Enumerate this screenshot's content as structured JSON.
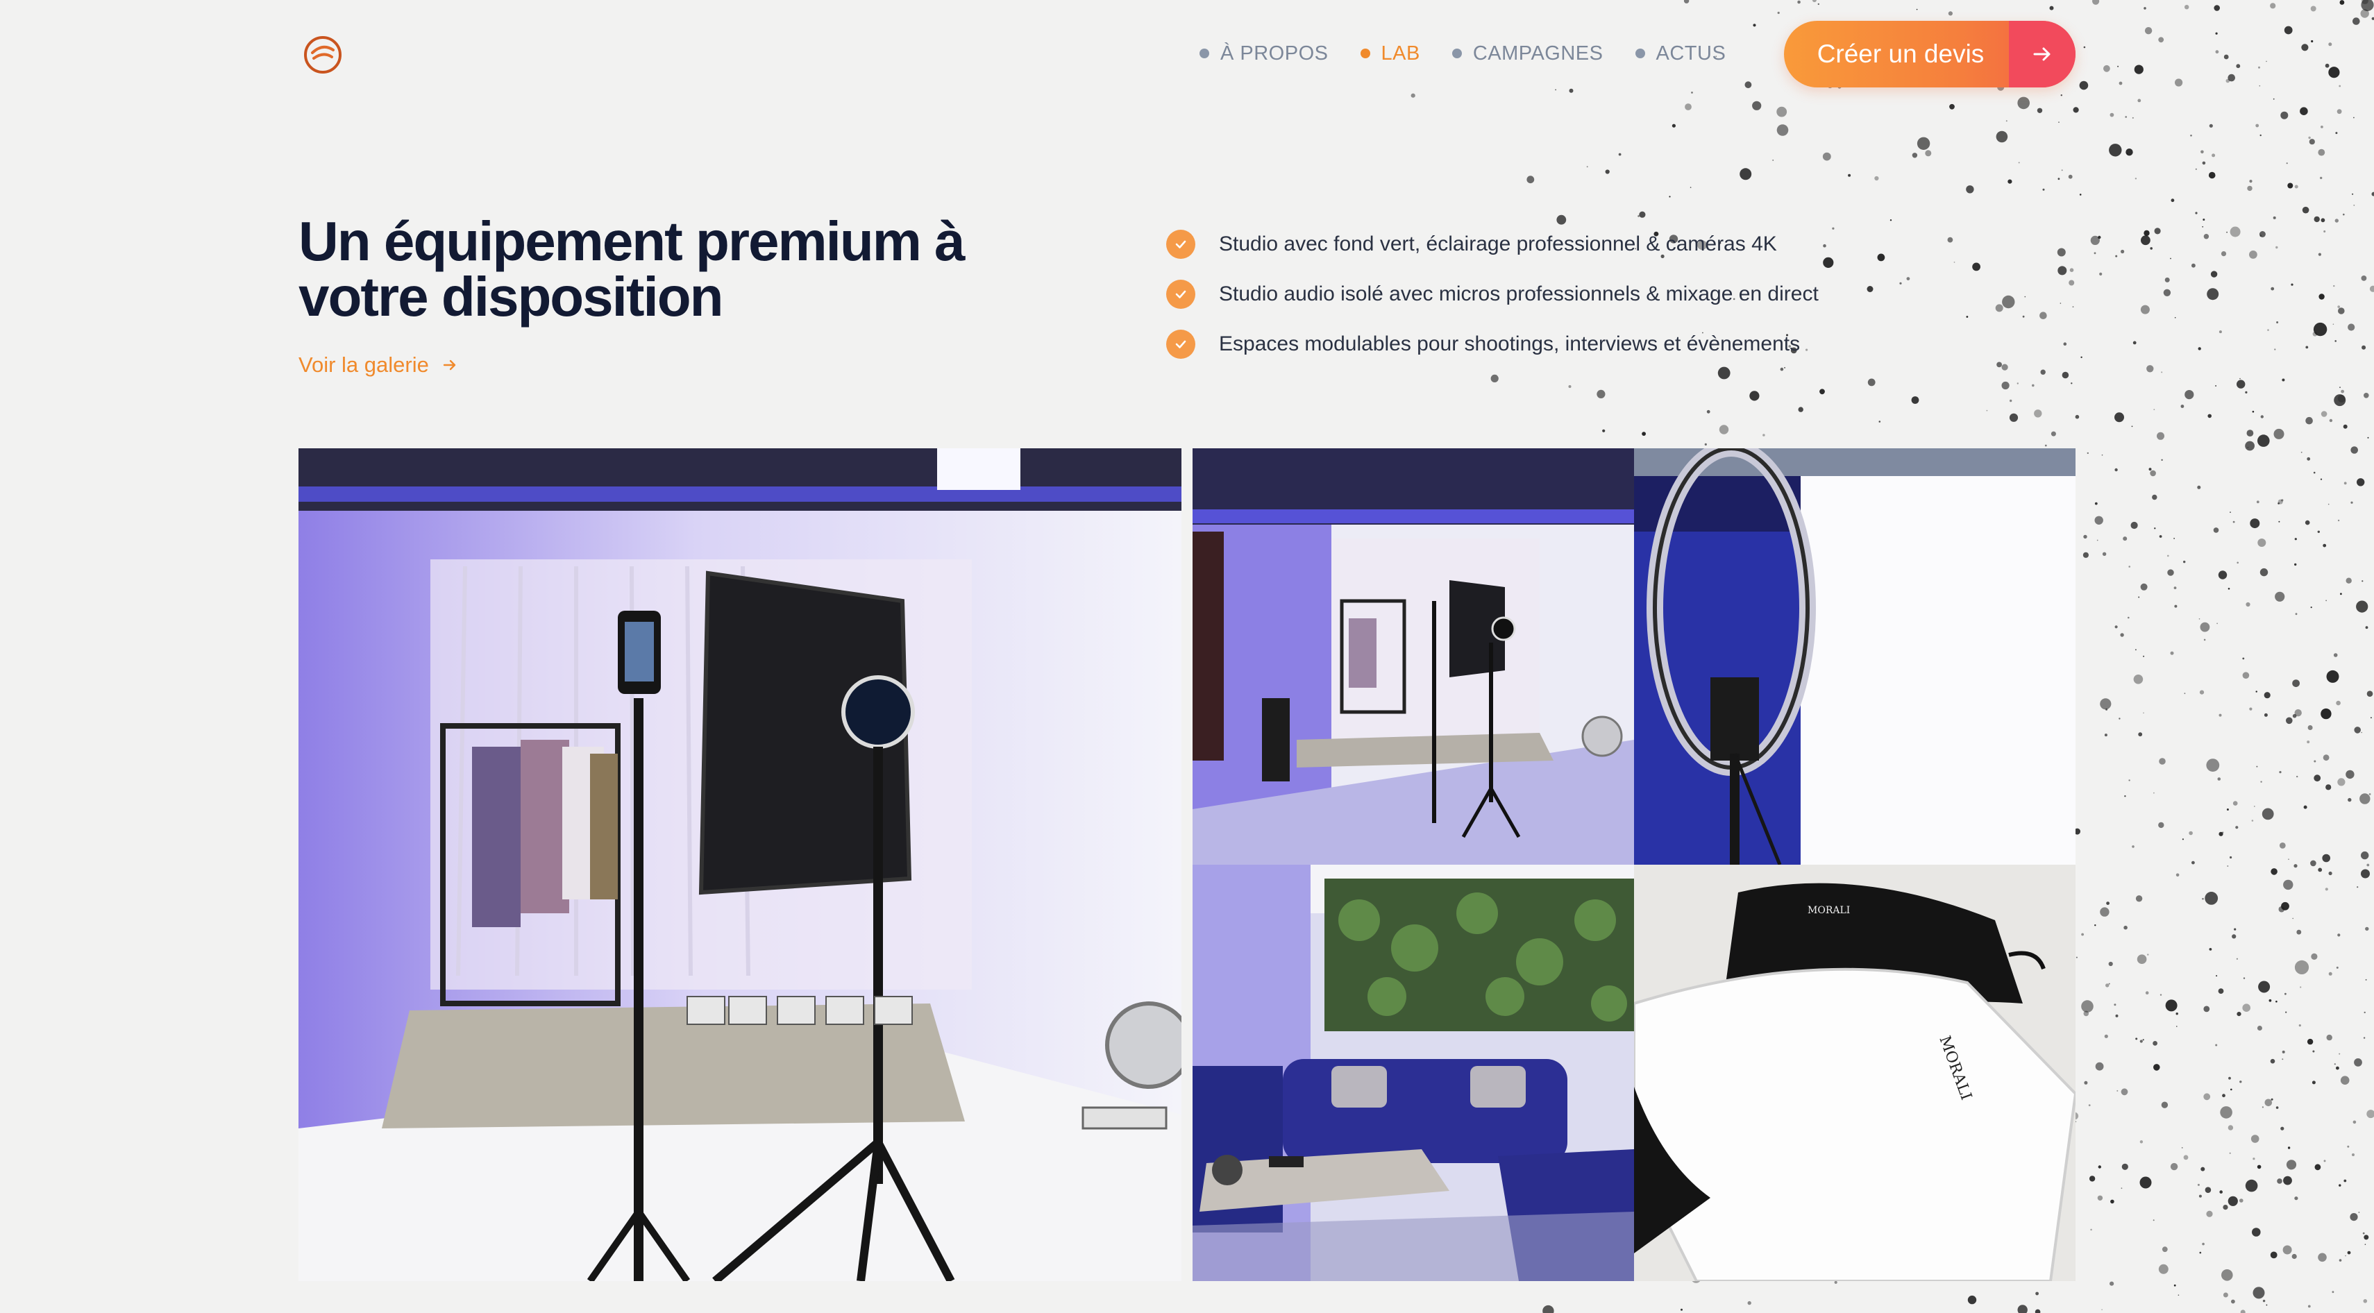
{
  "header": {
    "nav": [
      {
        "label": "À PROPOS",
        "active": false
      },
      {
        "label": "LAB",
        "active": true
      },
      {
        "label": "CAMPAGNES",
        "active": false
      },
      {
        "label": "ACTUS",
        "active": false
      }
    ],
    "cta_label": "Créer un devis"
  },
  "hero": {
    "title_line1": "Un équipement premium à",
    "title_line2": "votre disposition",
    "gallery_link": "Voir la galerie",
    "features": [
      "Studio avec fond vert, éclairage professionnel & caméras 4K",
      "Studio audio isolé avec micros professionnels & mixage en direct",
      "Espaces modulables pour shootings, interviews et évènements"
    ]
  },
  "gallery": {
    "photos": [
      "studio-main-photo",
      "studio-wide-photo",
      "ring-light-photo",
      "lounge-photo",
      "merch-photo"
    ],
    "print_brand": "MORALI"
  },
  "colors": {
    "accent": "#f08a2c",
    "title": "#121a33",
    "cta_start": "#f99a3a",
    "cta_end": "#f24a5c"
  }
}
